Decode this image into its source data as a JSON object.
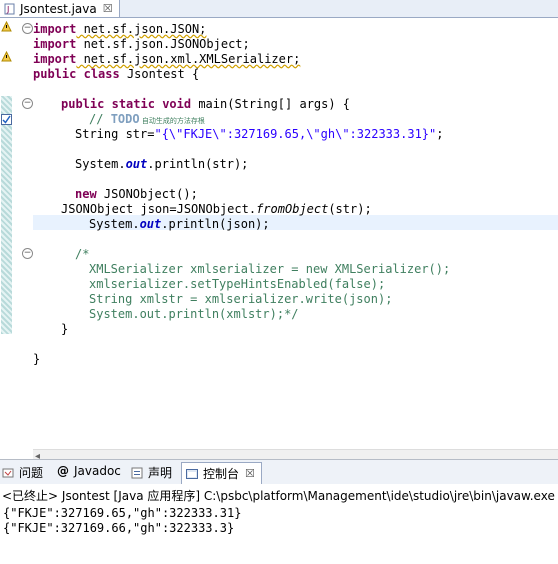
{
  "editor_tab": {
    "title": "Jsontest.java",
    "close": "☒"
  },
  "code": {
    "l1": [
      "import",
      " net.sf.json.JSON;"
    ],
    "l2": [
      "import",
      " net.sf.json.JSONObject;"
    ],
    "l3": [
      "import",
      " net.sf.json.xml.XMLSerializer;"
    ],
    "l4": [
      "public",
      " ",
      "class",
      " Jsontest {"
    ],
    "main_sig": [
      "public",
      " ",
      "static",
      " ",
      "void",
      " main(String[] args) {"
    ],
    "todo": [
      "// ",
      "TODO",
      " 自动生成的方法存根"
    ],
    "str_decl": [
      "String str=",
      "\"{\\\"FKJE\\\":327169.65,\\\"gh\\\":322333.31}\"",
      ";"
    ],
    "print1": [
      "System.",
      "out",
      ".println(str);"
    ],
    "new_obj": [
      "new",
      " JSONObject();"
    ],
    "json_decl": [
      "JSONObject json=JSONObject.",
      "fromObject",
      "(str);"
    ],
    "print2": [
      "System.",
      "out",
      ".println(json);"
    ],
    "c1": "/*",
    "c2": "XMLSerializer xmlserializer = new XMLSerializer();",
    "c3": "xmlserializer.setTypeHintsEnabled(false);",
    "c4": "String xmlstr = xmlserializer.write(json);",
    "c5": "System.out.println(xmlstr);*/",
    "close_method": "}",
    "close_class": "}"
  },
  "panel_tabs": [
    {
      "label": "问题"
    },
    {
      "label": "Javadoc"
    },
    {
      "label": "声明"
    },
    {
      "label": "控制台",
      "close": "☒"
    }
  ],
  "console": {
    "status": "<已终止> Jsontest [Java 应用程序] C:\\psbc\\platform\\Management\\ide\\studio\\jre\\bin\\javaw.exe (",
    "output": [
      "{\"FKJE\":327169.65,\"gh\":322333.31}",
      "{\"FKJE\":327169.66,\"gh\":322333.3}"
    ]
  }
}
